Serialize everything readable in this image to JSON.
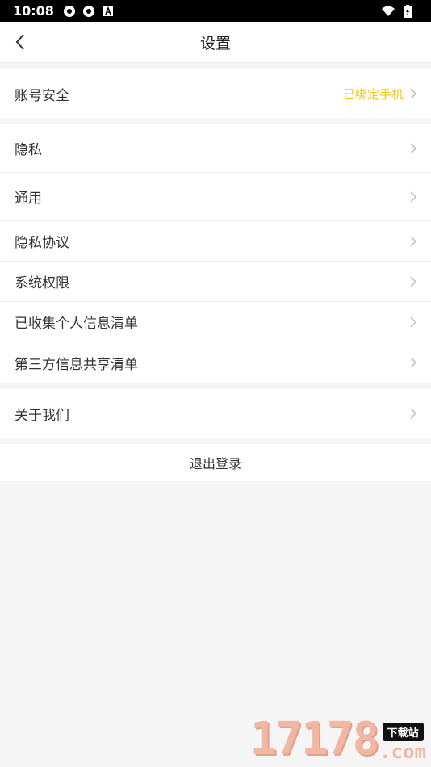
{
  "status_bar": {
    "time": "10:08"
  },
  "navbar": {
    "title": "设置"
  },
  "account_group": {
    "label": "账号安全",
    "value": "已绑定手机"
  },
  "settings_group": [
    {
      "label": "隐私"
    },
    {
      "label": "通用"
    },
    {
      "label": "隐私协议"
    },
    {
      "label": "系统权限"
    },
    {
      "label": "已收集个人信息清单"
    },
    {
      "label": "第三方信息共享清单"
    }
  ],
  "about_group": {
    "label": "关于我们"
  },
  "logout": {
    "label": "退出登录"
  },
  "watermark": {
    "number": "17178",
    "tag": "下载站",
    "domain": ".com"
  },
  "colors": {
    "accent": "#f5c518",
    "background": "#f5f5f5"
  }
}
